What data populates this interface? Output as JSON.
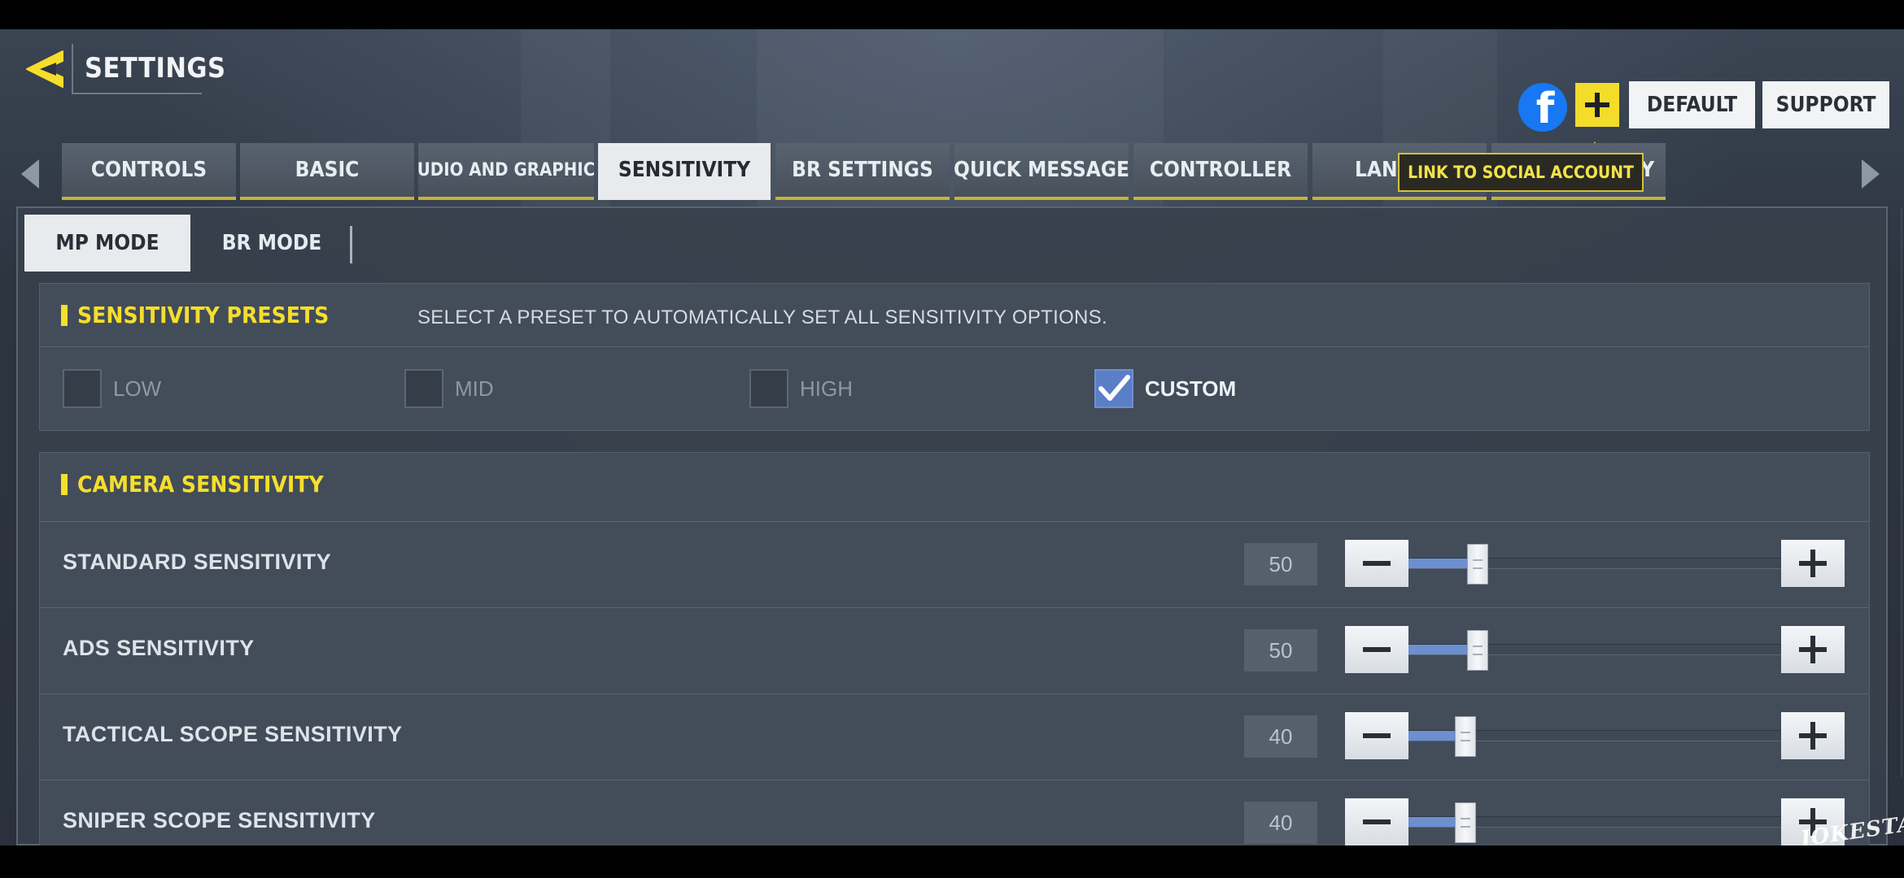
{
  "header": {
    "title": "SETTINGS",
    "default_label": "DEFAULT",
    "support_label": "SUPPORT",
    "facebook_glyph": "f",
    "tooltip": "LINK TO SOCIAL ACCOUNT",
    "brand_yellow": "#f3dd2a"
  },
  "tabs": [
    {
      "label": "CONTROLS",
      "active": false
    },
    {
      "label": "BASIC",
      "active": false
    },
    {
      "label": "AUDIO AND GRAPHICS",
      "active": false
    },
    {
      "label": "SENSITIVITY",
      "active": true
    },
    {
      "label": "BR SETTINGS",
      "active": false
    },
    {
      "label": "QUICK MESSAGE",
      "active": false
    },
    {
      "label": "CONTROLLER",
      "active": false
    },
    {
      "label": "LANG",
      "active": false
    },
    {
      "label": "ACY",
      "active": false
    }
  ],
  "modes": {
    "mp_label": "MP MODE",
    "br_label": "BR MODE",
    "active": "MP MODE"
  },
  "presets": {
    "title": "SENSITIVITY PRESETS",
    "description": "SELECT A PRESET TO AUTOMATICALLY SET ALL SENSITIVITY OPTIONS.",
    "options": [
      {
        "label": "LOW",
        "checked": false
      },
      {
        "label": "MID",
        "checked": false
      },
      {
        "label": "HIGH",
        "checked": false
      },
      {
        "label": "CUSTOM",
        "checked": true
      }
    ]
  },
  "camera": {
    "title": "CAMERA SENSITIVITY",
    "slider_max": 300,
    "rows": [
      {
        "label": "STANDARD SENSITIVITY",
        "value": "50"
      },
      {
        "label": "ADS SENSITIVITY",
        "value": "50"
      },
      {
        "label": "TACTICAL SCOPE SENSITIVITY",
        "value": "40"
      },
      {
        "label": "SNIPER SCOPE SENSITIVITY",
        "value": "40"
      }
    ]
  },
  "watermark": "JOKESTA"
}
